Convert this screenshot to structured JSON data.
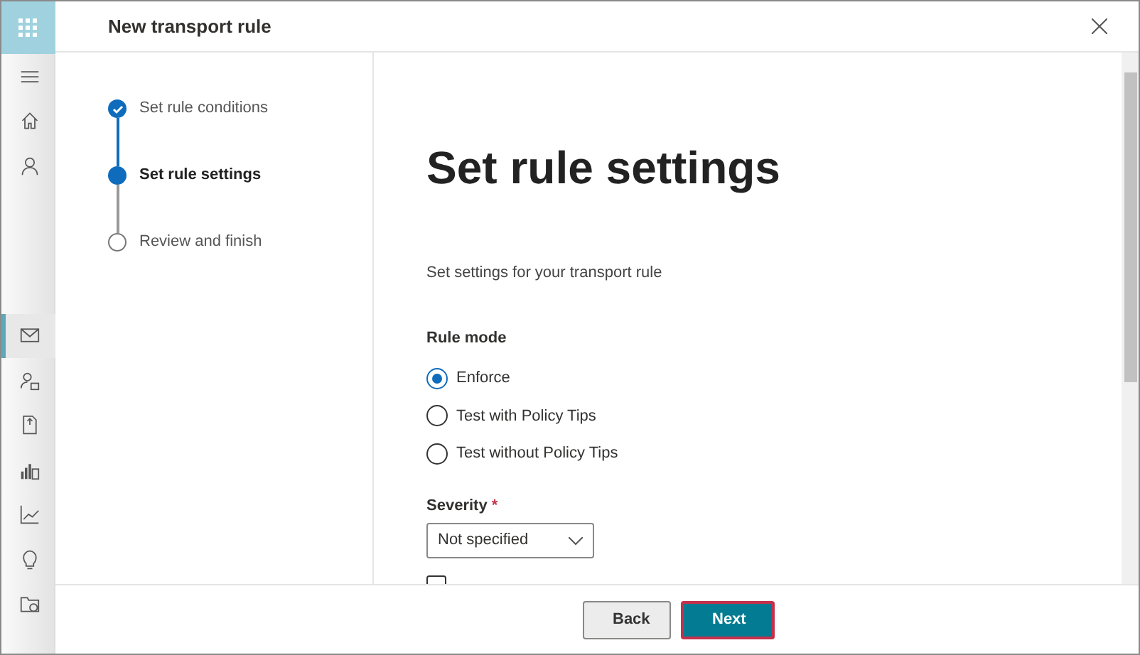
{
  "nav_rail": {
    "items": [
      {
        "kind": "menu",
        "selected": false
      },
      {
        "kind": "home",
        "selected": false
      },
      {
        "kind": "person",
        "selected": false
      },
      {
        "kind": "mail",
        "selected": true
      },
      {
        "kind": "contact",
        "selected": false
      },
      {
        "kind": "document",
        "selected": false
      },
      {
        "kind": "report",
        "selected": false
      },
      {
        "kind": "chart",
        "selected": false
      },
      {
        "kind": "bulb",
        "selected": false
      },
      {
        "kind": "folder",
        "selected": false
      }
    ]
  },
  "panel": {
    "title": "New transport rule"
  },
  "steps": [
    {
      "label": "Set rule conditions",
      "completed": true,
      "selected": false
    },
    {
      "label": "Set rule settings",
      "completed": false,
      "selected": true
    },
    {
      "label": "Review and finish",
      "completed": false,
      "selected": false
    }
  ],
  "content": {
    "heading": "Set rule settings",
    "description": "Set settings for your transport rule",
    "rule_mode": {
      "label": "Rule mode",
      "options": [
        {
          "label": "Enforce",
          "selected": true
        },
        {
          "label": "Test with Policy Tips",
          "selected": false
        },
        {
          "label": "Test without Policy Tips",
          "selected": false
        }
      ]
    },
    "severity": {
      "label": "Severity",
      "required_mark": "*",
      "value": "Not specified"
    },
    "activate_checkbox": {
      "checked": false
    }
  },
  "footer": {
    "buttons": [
      {
        "label": "Back",
        "kind": "secondary"
      },
      {
        "label": "Next",
        "kind": "primary"
      }
    ]
  }
}
